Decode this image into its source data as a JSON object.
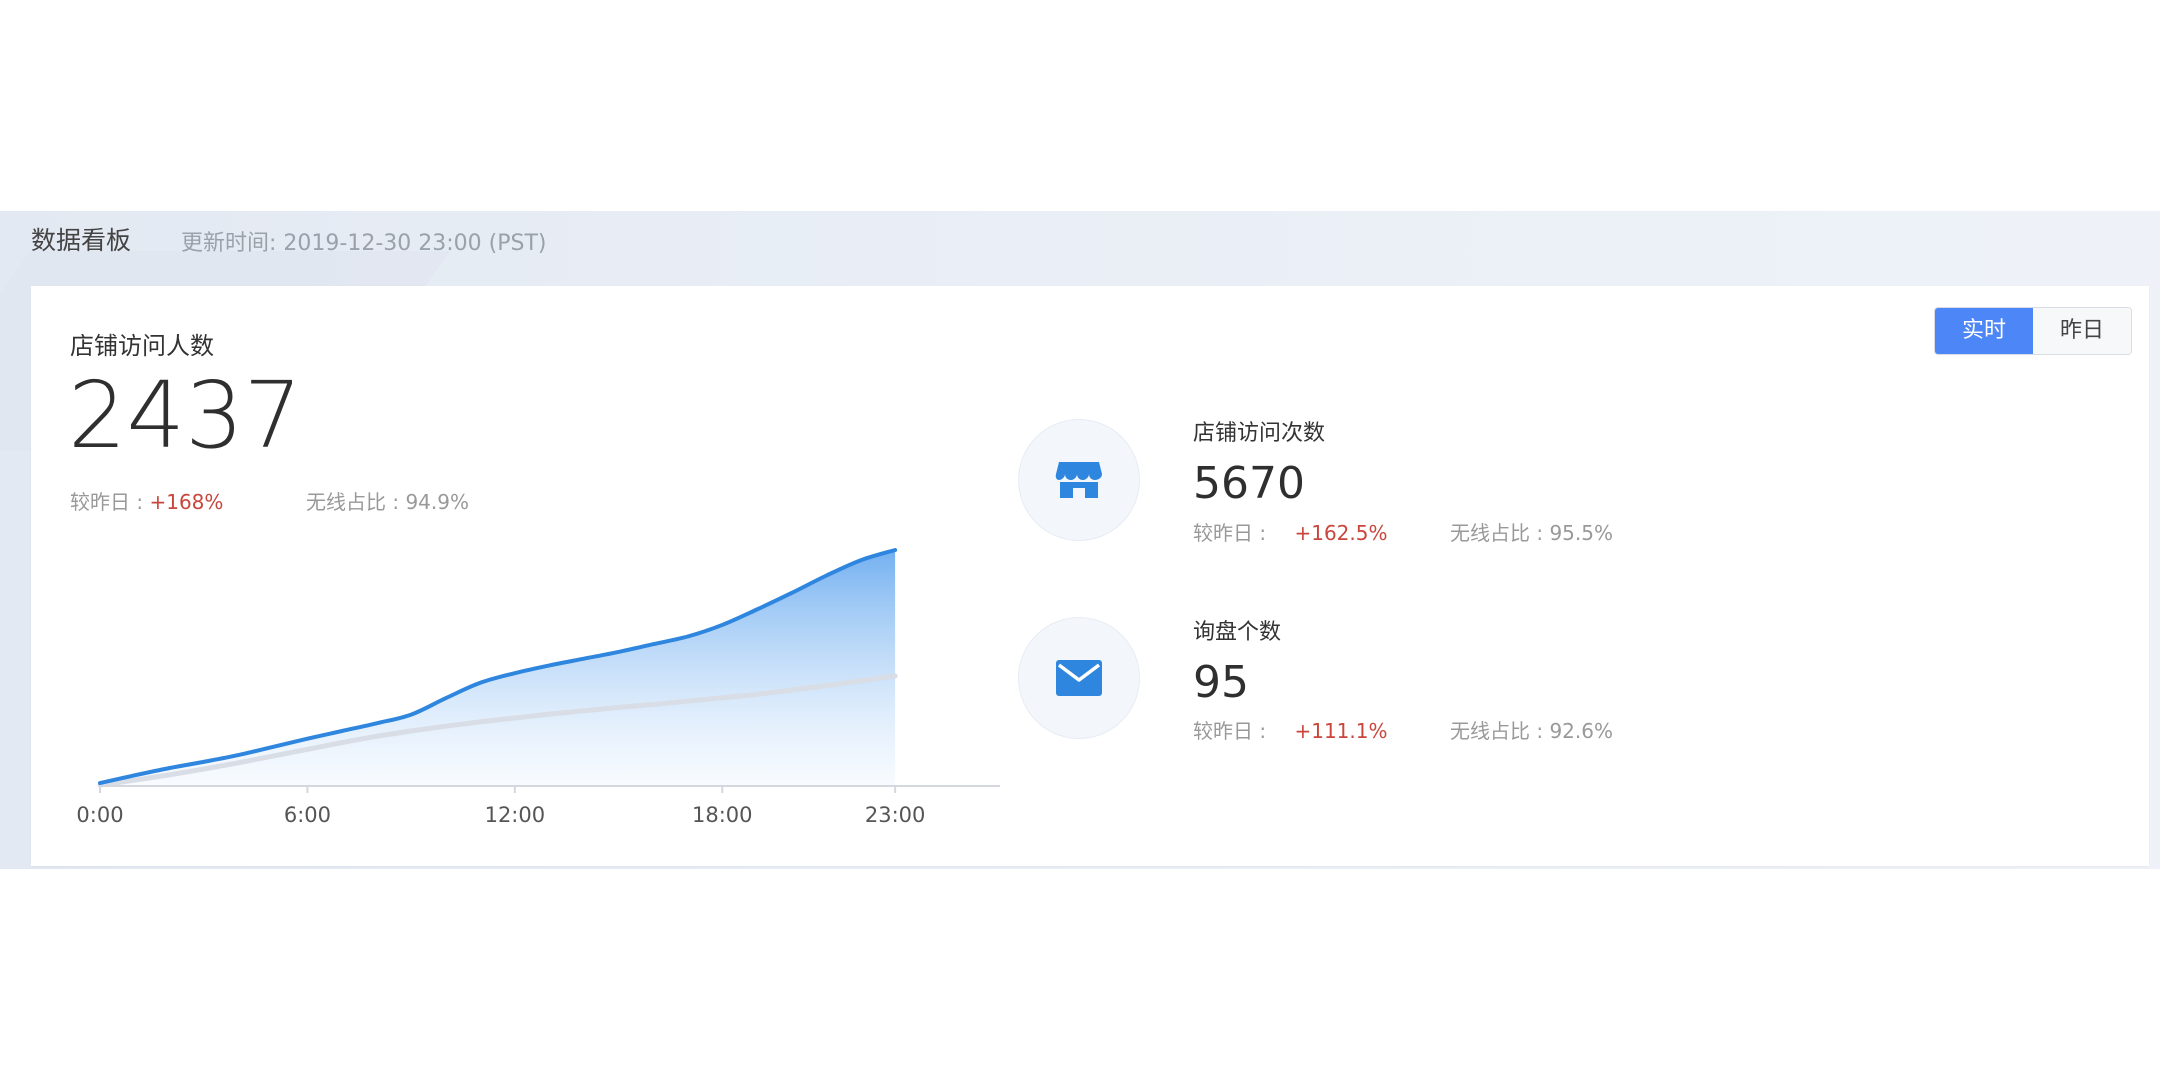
{
  "header": {
    "title": "数据看板",
    "update_time": "更新时间: 2019-12-30 23:00 (PST)"
  },
  "toggle": {
    "realtime": "实时",
    "yesterday": "昨日",
    "active": "realtime"
  },
  "main_metric": {
    "label": "店铺访问人数",
    "value": "2437",
    "compare_label": "较昨日 :",
    "compare_value": "+168%",
    "wireless_label": "无线占比",
    "wireless_value": ": 94.9%"
  },
  "metrics": [
    {
      "icon": "store-icon",
      "label": "店铺访问次数",
      "value": "5670",
      "compare_label": "较昨日 :",
      "compare_value": "+162.5%",
      "wireless_label": "无线占比",
      "wireless_value": ": 95.5%"
    },
    {
      "icon": "mail-icon",
      "label": "询盘个数",
      "value": "95",
      "compare_label": "较昨日 :",
      "compare_value": "+111.1%",
      "wireless_label": "无线占比",
      "wireless_value": ": 92.6%"
    }
  ],
  "colors": {
    "accent": "#4d86f7",
    "today_line": "#2f86de",
    "yesterday_line": "#d8dde6",
    "increase": "#c8463c"
  },
  "chart_data": {
    "type": "area",
    "x": [
      0,
      1,
      2,
      3,
      4,
      5,
      6,
      7,
      8,
      9,
      10,
      11,
      12,
      13,
      14,
      15,
      16,
      17,
      18,
      19,
      20,
      21,
      22,
      23
    ],
    "tick_labels": [
      "0:00",
      "6:00",
      "12:00",
      "18:00",
      "23:00"
    ],
    "tick_positions": [
      0,
      6,
      12,
      18,
      23
    ],
    "xlim": [
      0,
      25.6
    ],
    "ylim": [
      0,
      2437
    ],
    "series": [
      {
        "values": [
          20,
          100,
          175,
          240,
          310,
          395,
          480,
          560,
          640,
          730,
          900,
          1060,
          1160,
          1240,
          1310,
          1380,
          1460,
          1540,
          1660,
          1820,
          1990,
          2170,
          2330,
          2437
        ],
        "color": "#2f86de",
        "fill": true
      },
      {
        "values": [
          0,
          50,
          105,
          165,
          230,
          300,
          370,
          440,
          505,
          560,
          610,
          655,
          695,
          735,
          770,
          805,
          835,
          870,
          905,
          940,
          985,
          1030,
          1080,
          1130
        ],
        "color": "#d8dde6",
        "fill": false
      }
    ],
    "grid": false,
    "legend": "none"
  }
}
